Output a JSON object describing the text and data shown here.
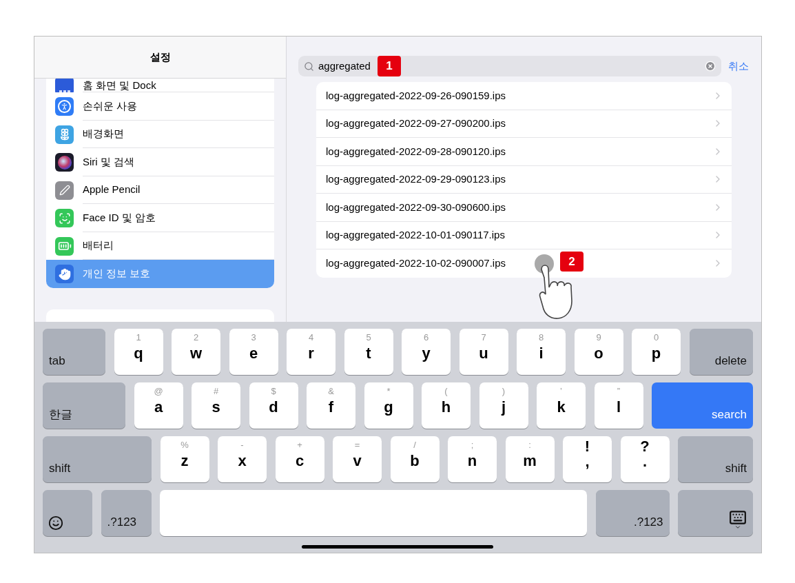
{
  "sidebar": {
    "title": "설정",
    "items": [
      {
        "label": "홈 화면 및 Dock",
        "kind": "dock",
        "selected": false
      },
      {
        "label": "손쉬운 사용",
        "kind": "accessibility",
        "selected": false
      },
      {
        "label": "배경화면",
        "kind": "wallpaper",
        "selected": false
      },
      {
        "label": "Siri 및 검색",
        "kind": "siri",
        "selected": false
      },
      {
        "label": "Apple Pencil",
        "kind": "pencil",
        "selected": false
      },
      {
        "label": "Face ID 및 암호",
        "kind": "faceid",
        "selected": false
      },
      {
        "label": "배터리",
        "kind": "battery",
        "selected": false
      },
      {
        "label": "개인 정보 보호",
        "kind": "privacy",
        "selected": true
      }
    ]
  },
  "search": {
    "value": "aggregated",
    "cancel": "취소"
  },
  "annotations": [
    {
      "label": "1"
    },
    {
      "label": "2"
    }
  ],
  "results": [
    "log-aggregated-2022-09-26-090159.ips",
    "log-aggregated-2022-09-27-090200.ips",
    "log-aggregated-2022-09-28-090120.ips",
    "log-aggregated-2022-09-29-090123.ips",
    "log-aggregated-2022-09-30-090600.ips",
    "log-aggregated-2022-10-01-090117.ips",
    "log-aggregated-2022-10-02-090007.ips"
  ],
  "keyboard": {
    "rows": [
      [
        {
          "kind": "modifier",
          "label": "tab"
        },
        {
          "kind": "letter",
          "sub": "1",
          "main": "q"
        },
        {
          "kind": "letter",
          "sub": "2",
          "main": "w"
        },
        {
          "kind": "letter",
          "sub": "3",
          "main": "e"
        },
        {
          "kind": "letter",
          "sub": "4",
          "main": "r"
        },
        {
          "kind": "letter",
          "sub": "5",
          "main": "t"
        },
        {
          "kind": "letter",
          "sub": "6",
          "main": "y"
        },
        {
          "kind": "letter",
          "sub": "7",
          "main": "u"
        },
        {
          "kind": "letter",
          "sub": "8",
          "main": "i"
        },
        {
          "kind": "letter",
          "sub": "9",
          "main": "o"
        },
        {
          "kind": "letter",
          "sub": "0",
          "main": "p"
        },
        {
          "kind": "function",
          "label": "delete"
        }
      ],
      [
        {
          "kind": "modifier",
          "label": "한글"
        },
        {
          "kind": "letter",
          "sub": "@",
          "main": "a"
        },
        {
          "kind": "letter",
          "sub": "#",
          "main": "s"
        },
        {
          "kind": "letter",
          "sub": "$",
          "main": "d"
        },
        {
          "kind": "letter",
          "sub": "&",
          "main": "f"
        },
        {
          "kind": "letter",
          "sub": "*",
          "main": "g"
        },
        {
          "kind": "letter",
          "sub": "(",
          "main": "h"
        },
        {
          "kind": "letter",
          "sub": ")",
          "main": "j"
        },
        {
          "kind": "letter",
          "sub": "’",
          "main": "k"
        },
        {
          "kind": "letter",
          "sub": "”",
          "main": "l"
        },
        {
          "kind": "action",
          "label": "search"
        }
      ],
      [
        {
          "kind": "modifier",
          "label": "shift"
        },
        {
          "kind": "letter",
          "sub": "%",
          "main": "z"
        },
        {
          "kind": "letter",
          "sub": "-",
          "main": "x"
        },
        {
          "kind": "letter",
          "sub": "+",
          "main": "c"
        },
        {
          "kind": "letter",
          "sub": "=",
          "main": "v"
        },
        {
          "kind": "letter",
          "sub": "/",
          "main": "b"
        },
        {
          "kind": "letter",
          "sub": ";",
          "main": "n"
        },
        {
          "kind": "letter",
          "sub": ":",
          "main": "m"
        },
        {
          "kind": "punct",
          "top": "!",
          "bottom": ","
        },
        {
          "kind": "punct",
          "top": "?",
          "bottom": "."
        },
        {
          "kind": "function",
          "label": "shift"
        }
      ],
      [
        {
          "kind": "emoji"
        },
        {
          "kind": "modifier",
          "label": ".?123"
        },
        {
          "kind": "space"
        },
        {
          "kind": "function",
          "label": ".?123"
        },
        {
          "kind": "hide"
        }
      ]
    ]
  }
}
